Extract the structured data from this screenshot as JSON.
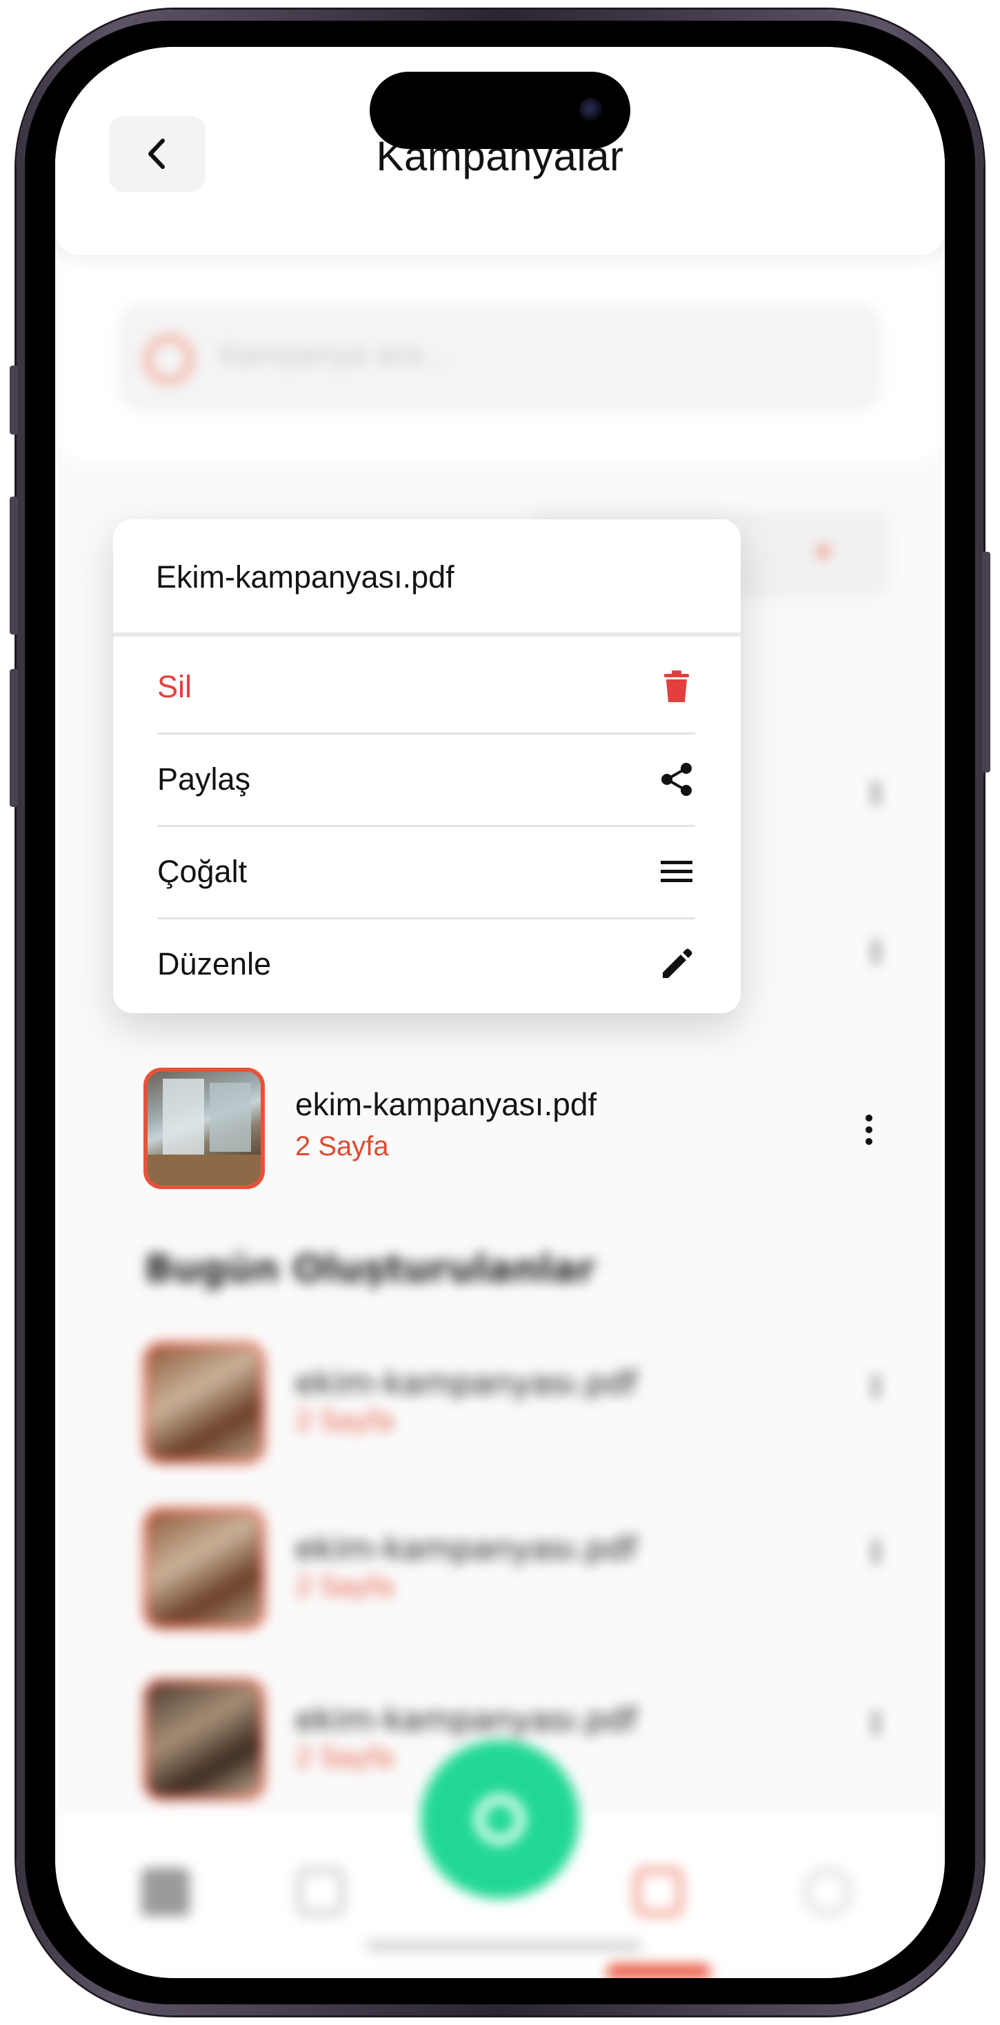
{
  "header": {
    "title": "Kampanyalar"
  },
  "search": {
    "placeholder": "Kampanya ara..."
  },
  "menu": {
    "file_name": "Ekim-kampanyası.pdf",
    "items": [
      {
        "label": "Sil",
        "icon": "trash-icon",
        "color": "#e43f3f"
      },
      {
        "label": "Paylaş",
        "icon": "share-icon"
      },
      {
        "label": "Çoğalt",
        "icon": "menu-lines-icon"
      },
      {
        "label": "Düzenle",
        "icon": "pencil-icon"
      }
    ]
  },
  "selected_file": {
    "name": "ekim-kampanyası.pdf",
    "pages": "2 Sayfa"
  },
  "today_section": {
    "title": "Bugün Oluşturulanlar",
    "files": [
      {
        "name": "ekim-kampanyası.pdf",
        "pages": "2 Sayfa"
      },
      {
        "name": "ekim-kampanyası.pdf",
        "pages": "2 Sayfa"
      },
      {
        "name": "ekim-kampanyası.pdf",
        "pages": "2 Sayfa"
      }
    ]
  },
  "colors": {
    "accent": "#e8523a",
    "danger": "#e43f3f",
    "fab": "#20d894"
  }
}
